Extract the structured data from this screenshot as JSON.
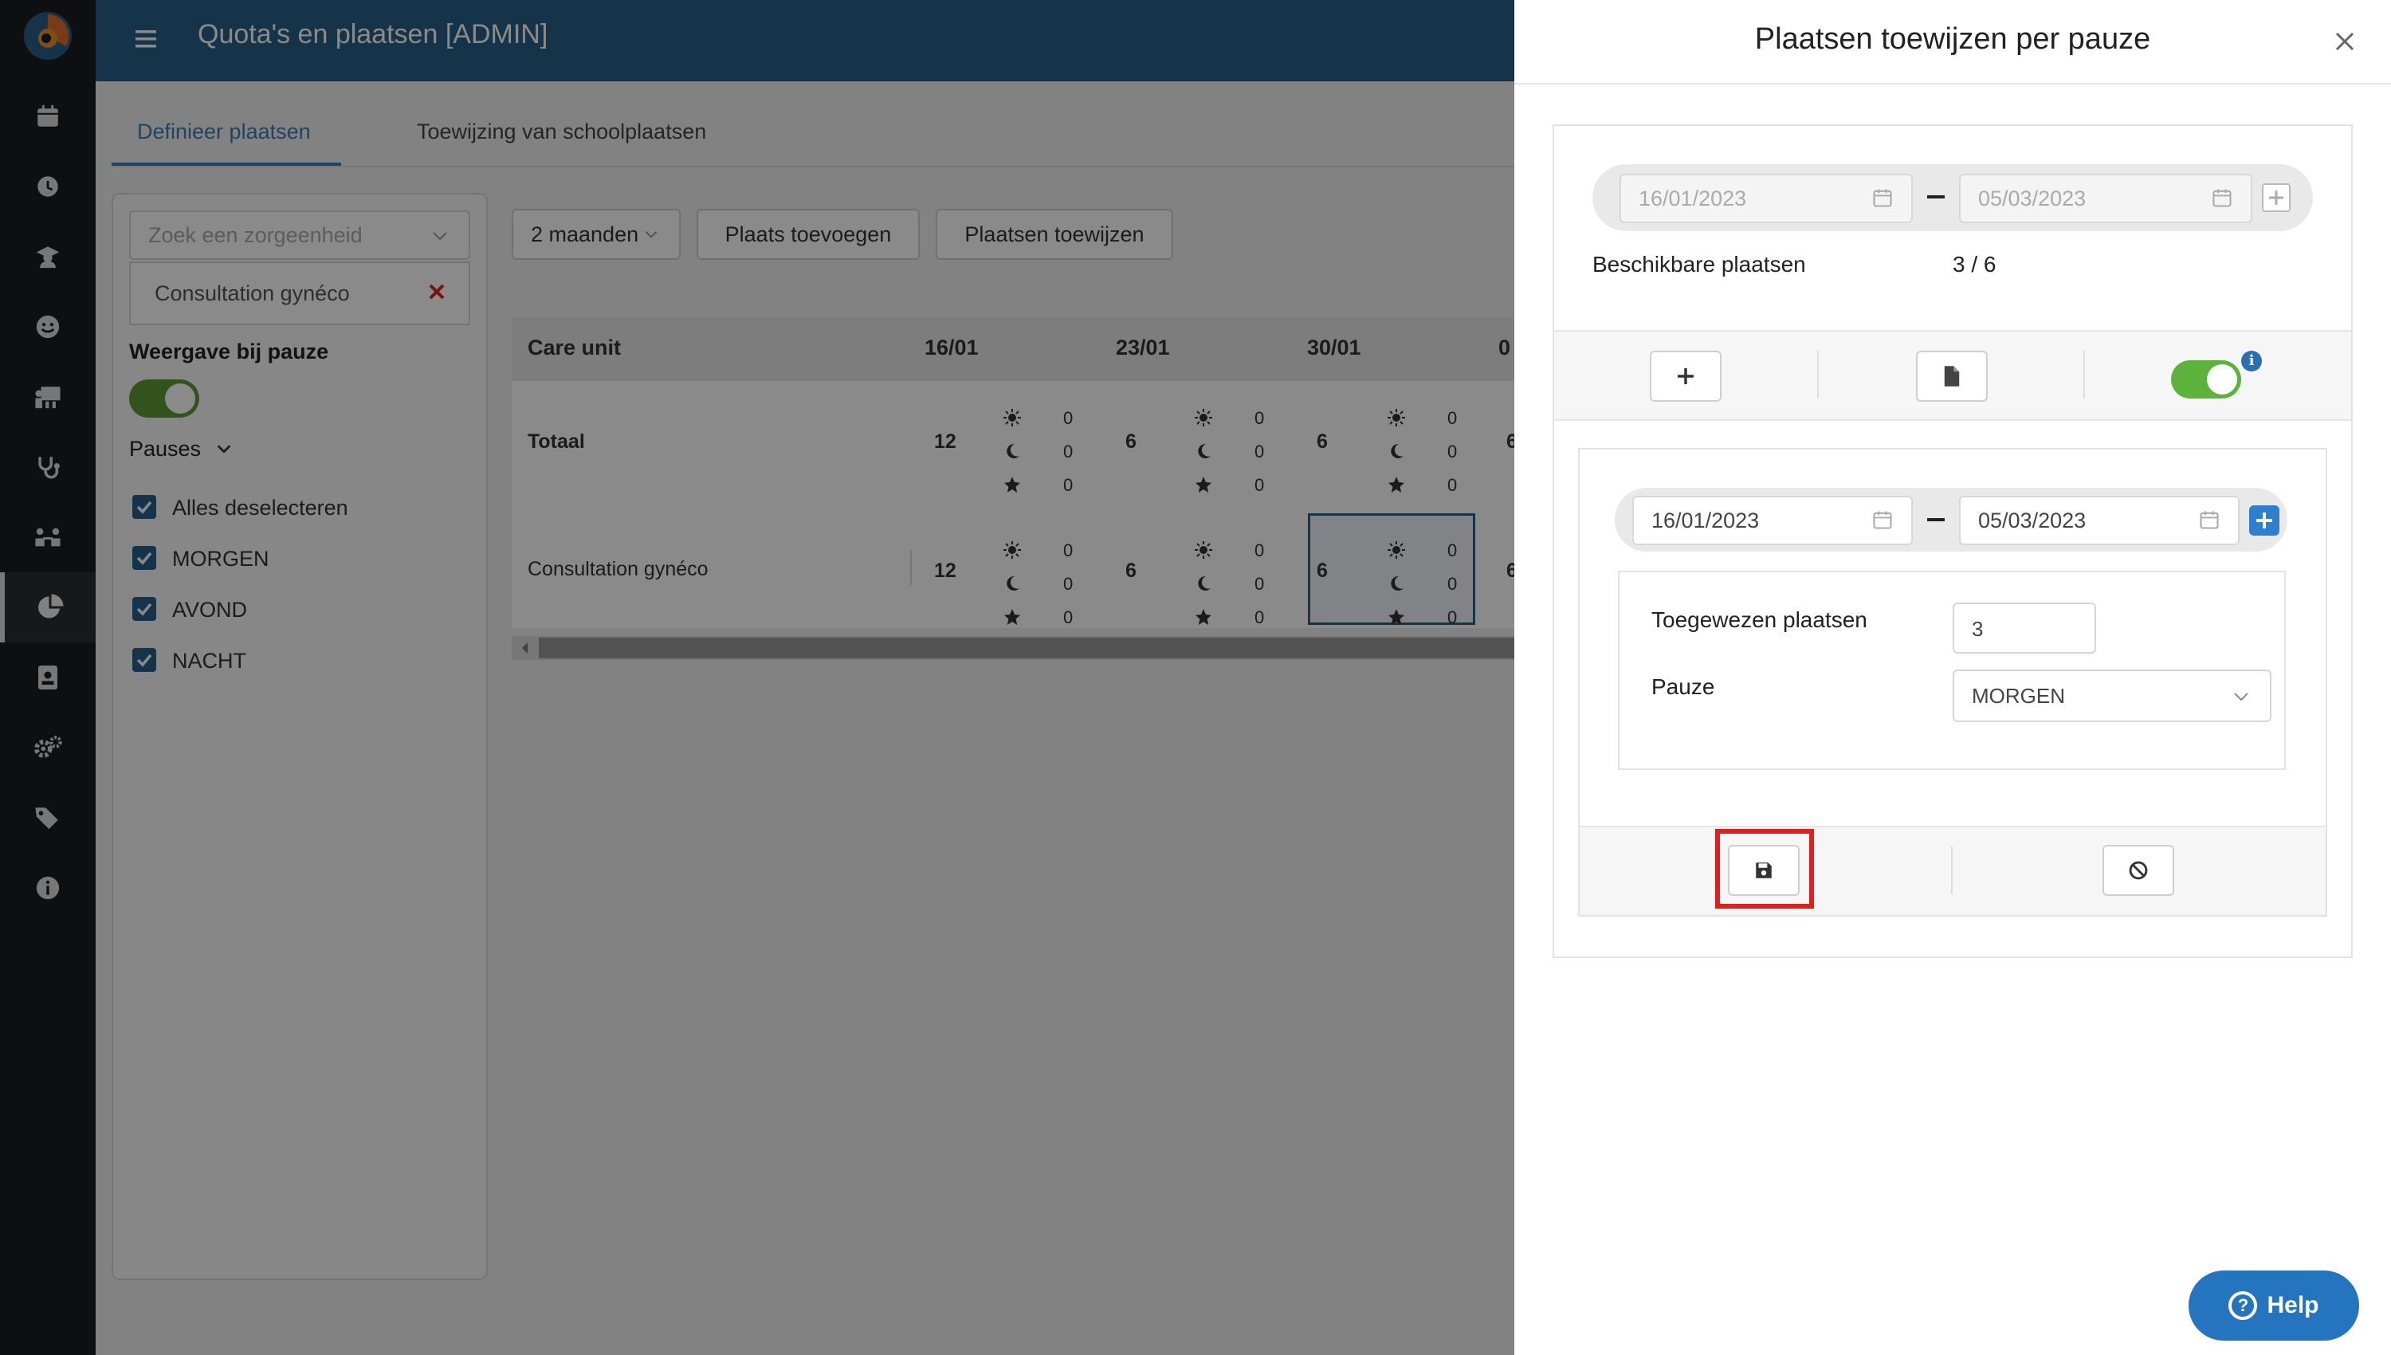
{
  "header": {
    "title": "Quota's en plaatsen [ADMIN]"
  },
  "tabs": [
    {
      "label": "Definieer plaatsen",
      "active": true
    },
    {
      "label": "Toewijzing van schoolplaatsen",
      "active": false
    }
  ],
  "filters": {
    "search_placeholder": "Zoek een zorgeenheid",
    "selected_unit": "Consultation gynéco",
    "weergave_label": "Weergave bij pauze",
    "weergave_on": true,
    "pauses_label": "Pauses",
    "checkboxes": [
      {
        "label": "Alles deselecteren",
        "checked": true
      },
      {
        "label": "MORGEN",
        "checked": true
      },
      {
        "label": "AVOND",
        "checked": true
      },
      {
        "label": "NACHT",
        "checked": true
      }
    ]
  },
  "toolbar": {
    "period": "2 maanden",
    "add_label": "Plaats toevoegen",
    "assign_label": "Plaatsen toewijzen"
  },
  "grid": {
    "col_unit": "Care unit",
    "weeks": [
      "16/01",
      "23/01",
      "30/01",
      "0"
    ],
    "rows": [
      {
        "label": "Totaal",
        "totals": [
          "12",
          "6",
          "6",
          "6"
        ],
        "breakdown": [
          "0",
          "0",
          "0"
        ]
      },
      {
        "label": "Consultation gynéco",
        "totals": [
          "12",
          "6",
          "6",
          "6"
        ],
        "breakdown": [
          "0",
          "0",
          "0"
        ]
      }
    ]
  },
  "drawer": {
    "title": "Plaatsen toewijzen per pauze",
    "range_from": "16/01/2023",
    "range_to": "05/03/2023",
    "available_label": "Beschikbare plaatsen",
    "available_value": "3 / 6",
    "toggle_on": true,
    "info_glyph": "i",
    "edit": {
      "from": "16/01/2023",
      "to": "05/03/2023",
      "assigned_label": "Toegewezen plaatsen",
      "assigned_value": "3",
      "pause_label": "Pauze",
      "pause_value": "MORGEN"
    }
  },
  "help": {
    "label": "Help",
    "glyph": "?"
  },
  "colors": {
    "header": "#2a6087",
    "rail": "#1b1d1e",
    "toggle": "#5cb23a",
    "highlight": "#e02020"
  },
  "icons": [
    "logo",
    "calendar-icon",
    "clock-icon",
    "school-icon",
    "smile-icon",
    "teacher-icon",
    "stethoscope-icon",
    "team-icon",
    "pie-chart-icon",
    "id-card-icon",
    "settings-icon",
    "tags-icon",
    "info-icon"
  ]
}
